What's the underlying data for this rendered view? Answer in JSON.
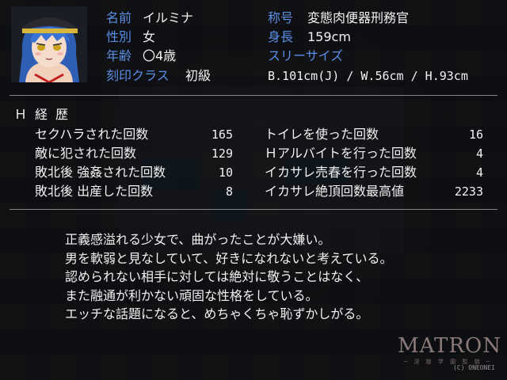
{
  "profile": {
    "name_label": "名前",
    "name": "イルミナ",
    "gender_label": "性別",
    "gender": "女",
    "age_label": "年齢",
    "age": "〇4歳",
    "class_label": "刻印クラス",
    "class": "初級",
    "title_label": "称号",
    "title": "変態肉便器刑務官",
    "height_label": "身長",
    "height": "159cm",
    "sizes_label": "スリーサイズ",
    "sizes": "B.101cm(J) / W.56cm / H.93cm"
  },
  "history": {
    "title": "Ｈ経歴",
    "left": [
      {
        "label": "セクハラされた回数",
        "count": "165"
      },
      {
        "label": "敵に犯された回数",
        "count": "129"
      },
      {
        "label": "敗北後 強姦された回数",
        "count": "10"
      },
      {
        "label": "敗北後 出産した回数",
        "count": "8"
      }
    ],
    "right": [
      {
        "label": "トイレを使った回数",
        "count": "16"
      },
      {
        "label": "Ｈアルバイトを行った回数",
        "count": "4"
      },
      {
        "label": "イカサレ売春を行った回数",
        "count": "4"
      },
      {
        "label": "イカサレ絶頂回数最高値",
        "count": "2233"
      }
    ]
  },
  "description": [
    "正義感溢れる少女で、曲がったことが大嫌い。",
    "男を軟弱と見なしていて、好きになれないと考えている。",
    "認められない相手に対しては絶対に敬うことはなく、",
    "また融通が利かない頑固な性格をしている。",
    "エッチな話題になると、めちゃくちゃ恥ずかしがる。"
  ],
  "logo": {
    "main": "MATRON",
    "sub": "─ 淫 獄 学 園 監 獄 ─",
    "copyright": "(C) ONEONEI"
  },
  "colors": {
    "label_blue": "#5a8fe6",
    "text_white": "#f2f2f2"
  },
  "icons": {
    "portrait": "character-portrait"
  }
}
